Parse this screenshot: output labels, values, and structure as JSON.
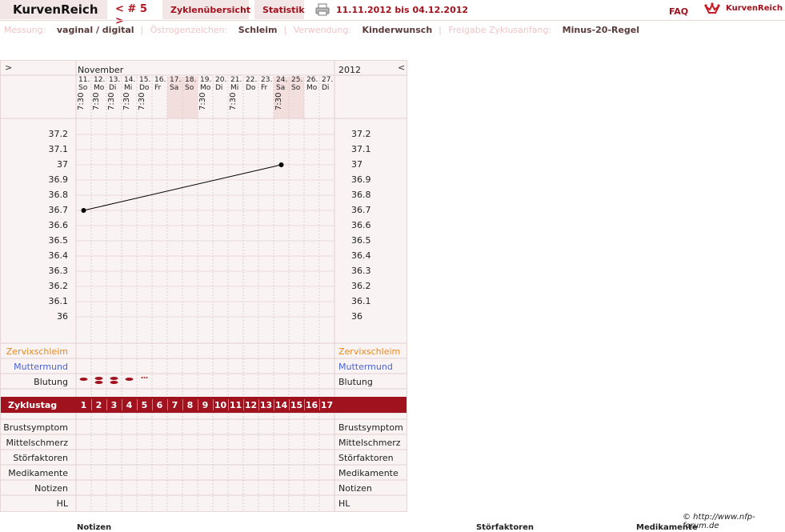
{
  "header": {
    "brand": "KurvenReich",
    "cycle_nav": "< # 5 >",
    "tabs": [
      "Zyklenübersicht",
      "Statistik"
    ],
    "date_range": "11.11.2012 bis 04.12.2012",
    "faq": "FAQ",
    "logo_text": "KurvenReich"
  },
  "settings": {
    "items": [
      {
        "label": "Messung:",
        "value": "vaginal / digital"
      },
      {
        "label": "Östrogenzeichen:",
        "value": "Schleim"
      },
      {
        "label": "Verwendung:",
        "value": "Kinderwunsch"
      },
      {
        "label": "Freigabe Zyklusanfang:",
        "value": "Minus-20-Regel"
      }
    ]
  },
  "chart": {
    "nav_left": ">",
    "nav_right": "<",
    "month": "November",
    "year": "2012",
    "days": [
      {
        "date": "11.",
        "dow": "So",
        "time": "7:30"
      },
      {
        "date": "12.",
        "dow": "Mo",
        "time": "7:30"
      },
      {
        "date": "13.",
        "dow": "Di",
        "time": "7:30"
      },
      {
        "date": "14.",
        "dow": "Mi",
        "time": "7:30"
      },
      {
        "date": "15.",
        "dow": "Do",
        "time": "7:30"
      },
      {
        "date": "16.",
        "dow": "Fr",
        "time": ""
      },
      {
        "date": "17.",
        "dow": "Sa",
        "time": ""
      },
      {
        "date": "18.",
        "dow": "So",
        "time": ""
      },
      {
        "date": "19.",
        "dow": "Mo",
        "time": "7:30"
      },
      {
        "date": "20.",
        "dow": "Di",
        "time": ""
      },
      {
        "date": "21.",
        "dow": "Mi",
        "time": "7:30"
      },
      {
        "date": "22.",
        "dow": "Do",
        "time": ""
      },
      {
        "date": "23.",
        "dow": "Fr",
        "time": ""
      },
      {
        "date": "24.",
        "dow": "Sa",
        "time": "7:30"
      },
      {
        "date": "25.",
        "dow": "So",
        "time": ""
      },
      {
        "date": "26.",
        "dow": "Mo",
        "time": ""
      },
      {
        "date": "27.",
        "dow": "Di",
        "time": ""
      }
    ],
    "weekend_highlight": [
      6,
      7,
      13,
      14
    ],
    "y_ticks": [
      "37.2",
      "37.1",
      "37",
      "36.9",
      "36.8",
      "36.7",
      "36.6",
      "36.5",
      "36.4",
      "36.3",
      "36.2",
      "36.1",
      "36"
    ],
    "row_labels_left": [
      "Zervixschleim",
      "Muttermund",
      "Blutung"
    ],
    "row_labels_right": [
      "Zervixschleim",
      "Muttermund",
      "Blutung"
    ],
    "cycle_label": "Zyklustag",
    "cycle_days": [
      "1",
      "2",
      "3",
      "4",
      "5",
      "6",
      "7",
      "8",
      "9",
      "10",
      "11",
      "12",
      "13",
      "14",
      "15",
      "16",
      "17"
    ],
    "lower_rows": [
      "Brustsymptom",
      "Mittelschmerz",
      "Störfaktoren",
      "Medikamente",
      "Notizen",
      "HL"
    ],
    "bleeding": [
      {
        "day_index": 0,
        "level": 1
      },
      {
        "day_index": 1,
        "level": 2
      },
      {
        "day_index": 2,
        "level": 2
      },
      {
        "day_index": 3,
        "level": 1
      },
      {
        "day_index": 4,
        "level": 0
      }
    ],
    "colors": {
      "accent": "#a0121d",
      "temp_line": "#000000",
      "cervix": "#e8891c",
      "cervix_pos": "#4a64d2"
    }
  },
  "chart_data": {
    "type": "line",
    "x": [
      "11.",
      "24."
    ],
    "series": [
      {
        "values": [
          36.7,
          37.0
        ]
      }
    ],
    "ylim": [
      36,
      37.2
    ]
  },
  "footer": {
    "copyright": "© http://www.nfp-forum.de",
    "cut_labels": [
      "Notizen",
      "Störfaktoren",
      "Medikamente"
    ]
  }
}
